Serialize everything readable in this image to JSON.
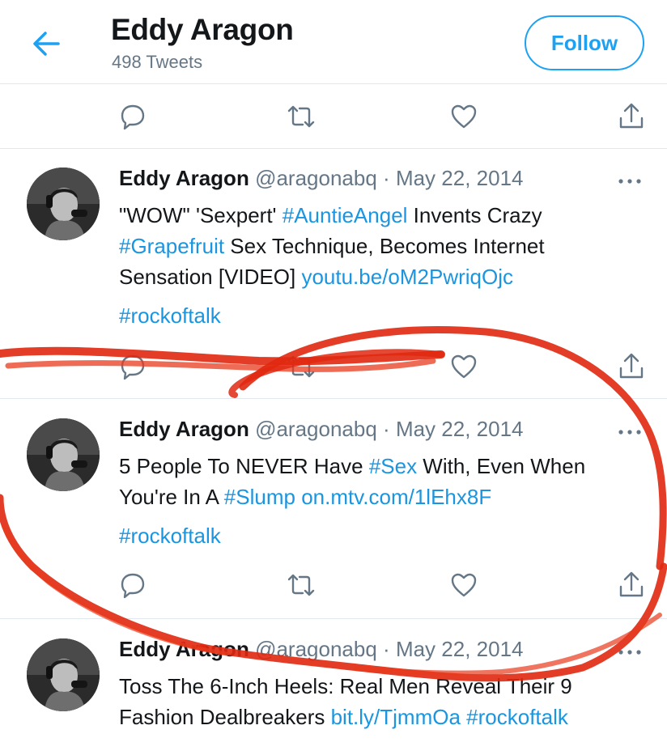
{
  "header": {
    "name": "Eddy Aragon",
    "tweet_count": "498 Tweets",
    "follow_label": "Follow"
  },
  "tweets": [
    {
      "author": "Eddy Aragon",
      "handle": "@aragonabq",
      "dot": "·",
      "date": "May 22, 2014",
      "lines": [
        [
          {
            "t": "\"WOW\" 'Sexpert' ",
            "link": false
          },
          {
            "t": "#AuntieAngel",
            "link": true
          },
          {
            "t": " Invents Crazy",
            "link": false
          }
        ],
        [
          {
            "t": "#Grapefruit",
            "link": true
          },
          {
            "t": " Sex Technique, Becomes Internet",
            "link": false
          }
        ],
        [
          {
            "t": "Sensation [VIDEO] ",
            "link": false
          },
          {
            "t": "youtu.be/oM2PwriqOjc",
            "link": true
          }
        ],
        [
          {
            "t": "#rockoftalk",
            "link": true
          }
        ]
      ]
    },
    {
      "author": "Eddy Aragon",
      "handle": "@aragonabq",
      "dot": "·",
      "date": "May 22, 2014",
      "lines": [
        [
          {
            "t": "5 People To NEVER Have ",
            "link": false
          },
          {
            "t": "#Sex",
            "link": true
          },
          {
            "t": " With, Even When",
            "link": false
          }
        ],
        [
          {
            "t": "You're In A ",
            "link": false
          },
          {
            "t": "#Slump",
            "link": true
          },
          {
            "t": " ",
            "link": false
          },
          {
            "t": "on.mtv.com/1lEhx8F",
            "link": true
          }
        ],
        [
          {
            "t": "#rockoftalk",
            "link": true
          }
        ]
      ]
    },
    {
      "author": "Eddy Aragon",
      "handle": "@aragonabq",
      "dot": "·",
      "date": "May 22, 2014",
      "lines": [
        [
          {
            "t": "Toss The 6-Inch Heels: Real Men Reveal Their 9",
            "link": false
          }
        ],
        [
          {
            "t": "Fashion Dealbreakers   ",
            "link": false
          },
          {
            "t": "bit.ly/TjmmOa",
            "link": true
          },
          {
            "t": " ",
            "link": false
          },
          {
            "t": "#rockoftalk",
            "link": true
          }
        ]
      ]
    }
  ],
  "colors": {
    "accent": "#1da1f2",
    "link": "#1b95e0",
    "secondary_text": "#657786",
    "annotation_red": "#e02810"
  },
  "icons": [
    "back-arrow-icon",
    "reply-icon",
    "retweet-icon",
    "like-icon",
    "share-icon",
    "more-icon"
  ]
}
